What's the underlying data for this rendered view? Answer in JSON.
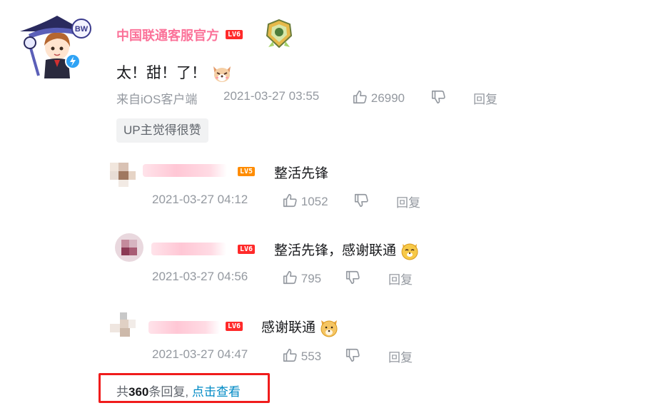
{
  "main_comment": {
    "username": "中国联通客服官方",
    "level": "LV6",
    "text": "太！甜！了！",
    "source": "来自iOS客户端",
    "timestamp": "2021-03-27 03:55",
    "likes": "26990",
    "reply_label": "回复",
    "up_liked_tag": "UP主觉得很赞"
  },
  "replies": [
    {
      "level": "LV5",
      "text": "整活先锋",
      "timestamp": "2021-03-27 04:12",
      "likes": "1052",
      "reply_label": "回复"
    },
    {
      "level": "LV6",
      "text": "整活先锋，感谢联通",
      "timestamp": "2021-03-27 04:56",
      "likes": "795",
      "reply_label": "回复"
    },
    {
      "level": "LV6",
      "text": "感谢联通",
      "timestamp": "2021-03-27 04:47",
      "likes": "553",
      "reply_label": "回复"
    }
  ],
  "more_replies": {
    "prefix": "共",
    "count": "360",
    "suffix": "条回复,",
    "link": "点击查看"
  },
  "colors": {
    "username_pink": "#fb7299",
    "meta_gray": "#9499a0",
    "link_blue": "#008ac5",
    "highlight_red": "#f01c1c"
  },
  "icons": {
    "like": "thumbs-up-icon",
    "dislike": "thumbs-down-icon",
    "verified": "lightning-verified-icon"
  }
}
